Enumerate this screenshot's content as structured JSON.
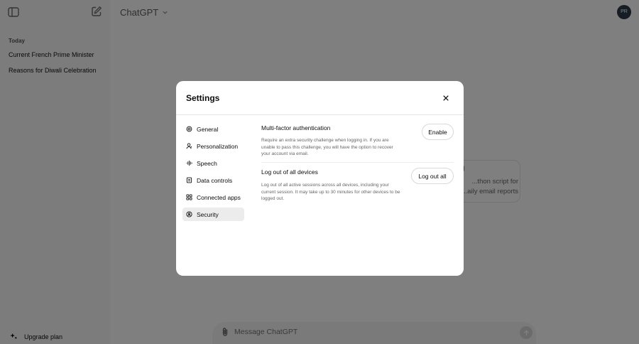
{
  "app": {
    "title": "ChatGPT",
    "avatar_initials": "PR"
  },
  "sidebar": {
    "history_heading": "Today",
    "history": [
      "Current French Prime Minister",
      "Reasons for Diwali Celebration"
    ],
    "upgrade_label": "Upgrade plan"
  },
  "suggestion": {
    "text": "...thon script for ...aily email reports"
  },
  "composer": {
    "placeholder": "Message ChatGPT"
  },
  "settings": {
    "title": "Settings",
    "nav": [
      {
        "label": "General",
        "icon": "gear-icon"
      },
      {
        "label": "Personalization",
        "icon": "person-icon"
      },
      {
        "label": "Speech",
        "icon": "waveform-icon"
      },
      {
        "label": "Data controls",
        "icon": "data-icon"
      },
      {
        "label": "Connected apps",
        "icon": "grid-icon"
      },
      {
        "label": "Security",
        "icon": "lock-icon",
        "active": true
      }
    ],
    "sections": {
      "mfa": {
        "title": "Multi-factor authentication",
        "description": "Require an extra security challenge when logging in. If you are unable to pass this challenge, you will have the option to recover your account via email.",
        "button": "Enable"
      },
      "logout": {
        "title": "Log out of all devices",
        "description": "Log out of all active sessions across all devices, including your current session. It may take up to 30 minutes for other devices to be logged out.",
        "button": "Log out all"
      }
    }
  },
  "colors": {
    "overlay": "#000000",
    "accent_red": "#e55353"
  }
}
